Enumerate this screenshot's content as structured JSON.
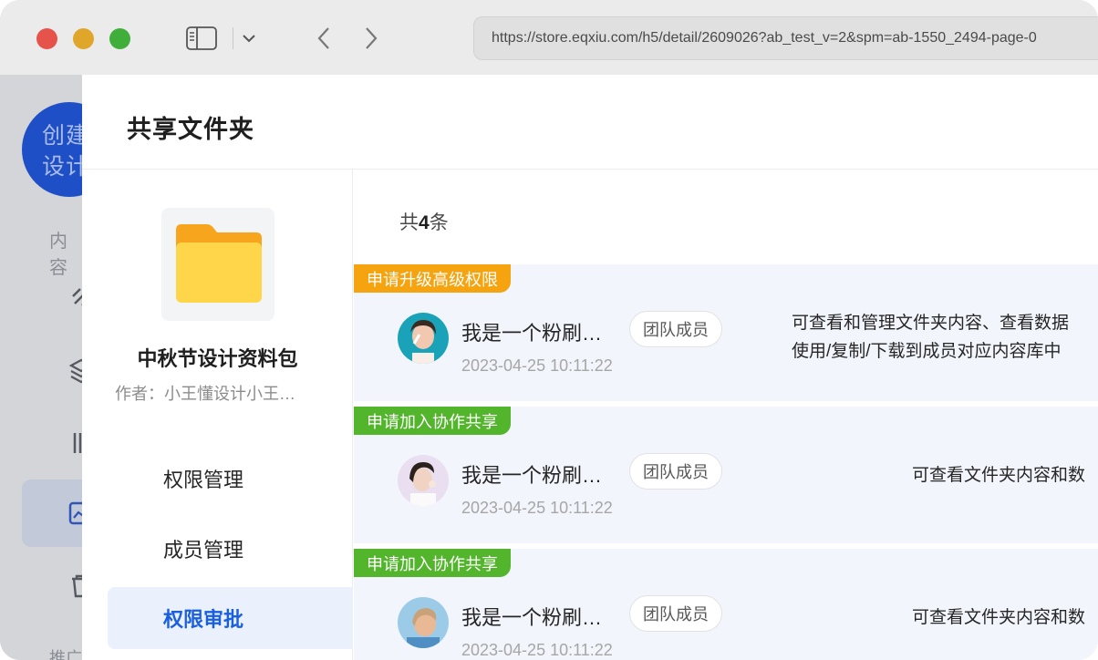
{
  "browser": {
    "url": "https://store.eqxiu.com/h5/detail/2609026?ab_test_v=2&spm=ab-1550_2494-page-0"
  },
  "background_app": {
    "create_button": [
      "创建",
      "设计"
    ],
    "section_label": "内容",
    "bottom_label": "推广"
  },
  "modal": {
    "title": "共享文件夹",
    "folder": {
      "name": "中秋节设计资料包",
      "author": "作者：小王懂设计小王…"
    },
    "nav": [
      {
        "label": "权限管理"
      },
      {
        "label": "成员管理"
      },
      {
        "label": "权限审批",
        "active": true
      }
    ],
    "count": {
      "prefix": "共",
      "value": "4",
      "suffix": "条"
    },
    "requests": [
      {
        "tag": "申请升级高级权限",
        "user": "我是一个粉刷…",
        "role": "团队成员",
        "time": "2023-04-25 10:11:22",
        "desc_line1": "可查看和管理文件夹内容、查看数据",
        "desc_line2": "使用/复制/下载到成员对应内容库中"
      },
      {
        "tag": "申请加入协作共享",
        "user": "我是一个粉刷…",
        "role": "团队成员",
        "time": "2023-04-25 10:11:22",
        "desc_line1": "可查看文件夹内容和数"
      },
      {
        "tag": "申请加入协作共享",
        "user": "我是一个粉刷…",
        "role": "团队成员",
        "time": "2023-04-25 10:11:22",
        "desc_line1": "可查看文件夹内容和数"
      }
    ]
  },
  "colors": {
    "primary": "#1a5fe0",
    "tag_orange": "#f5a30f",
    "tag_green": "#52b52b",
    "row_bg": "#f2f5fb"
  }
}
